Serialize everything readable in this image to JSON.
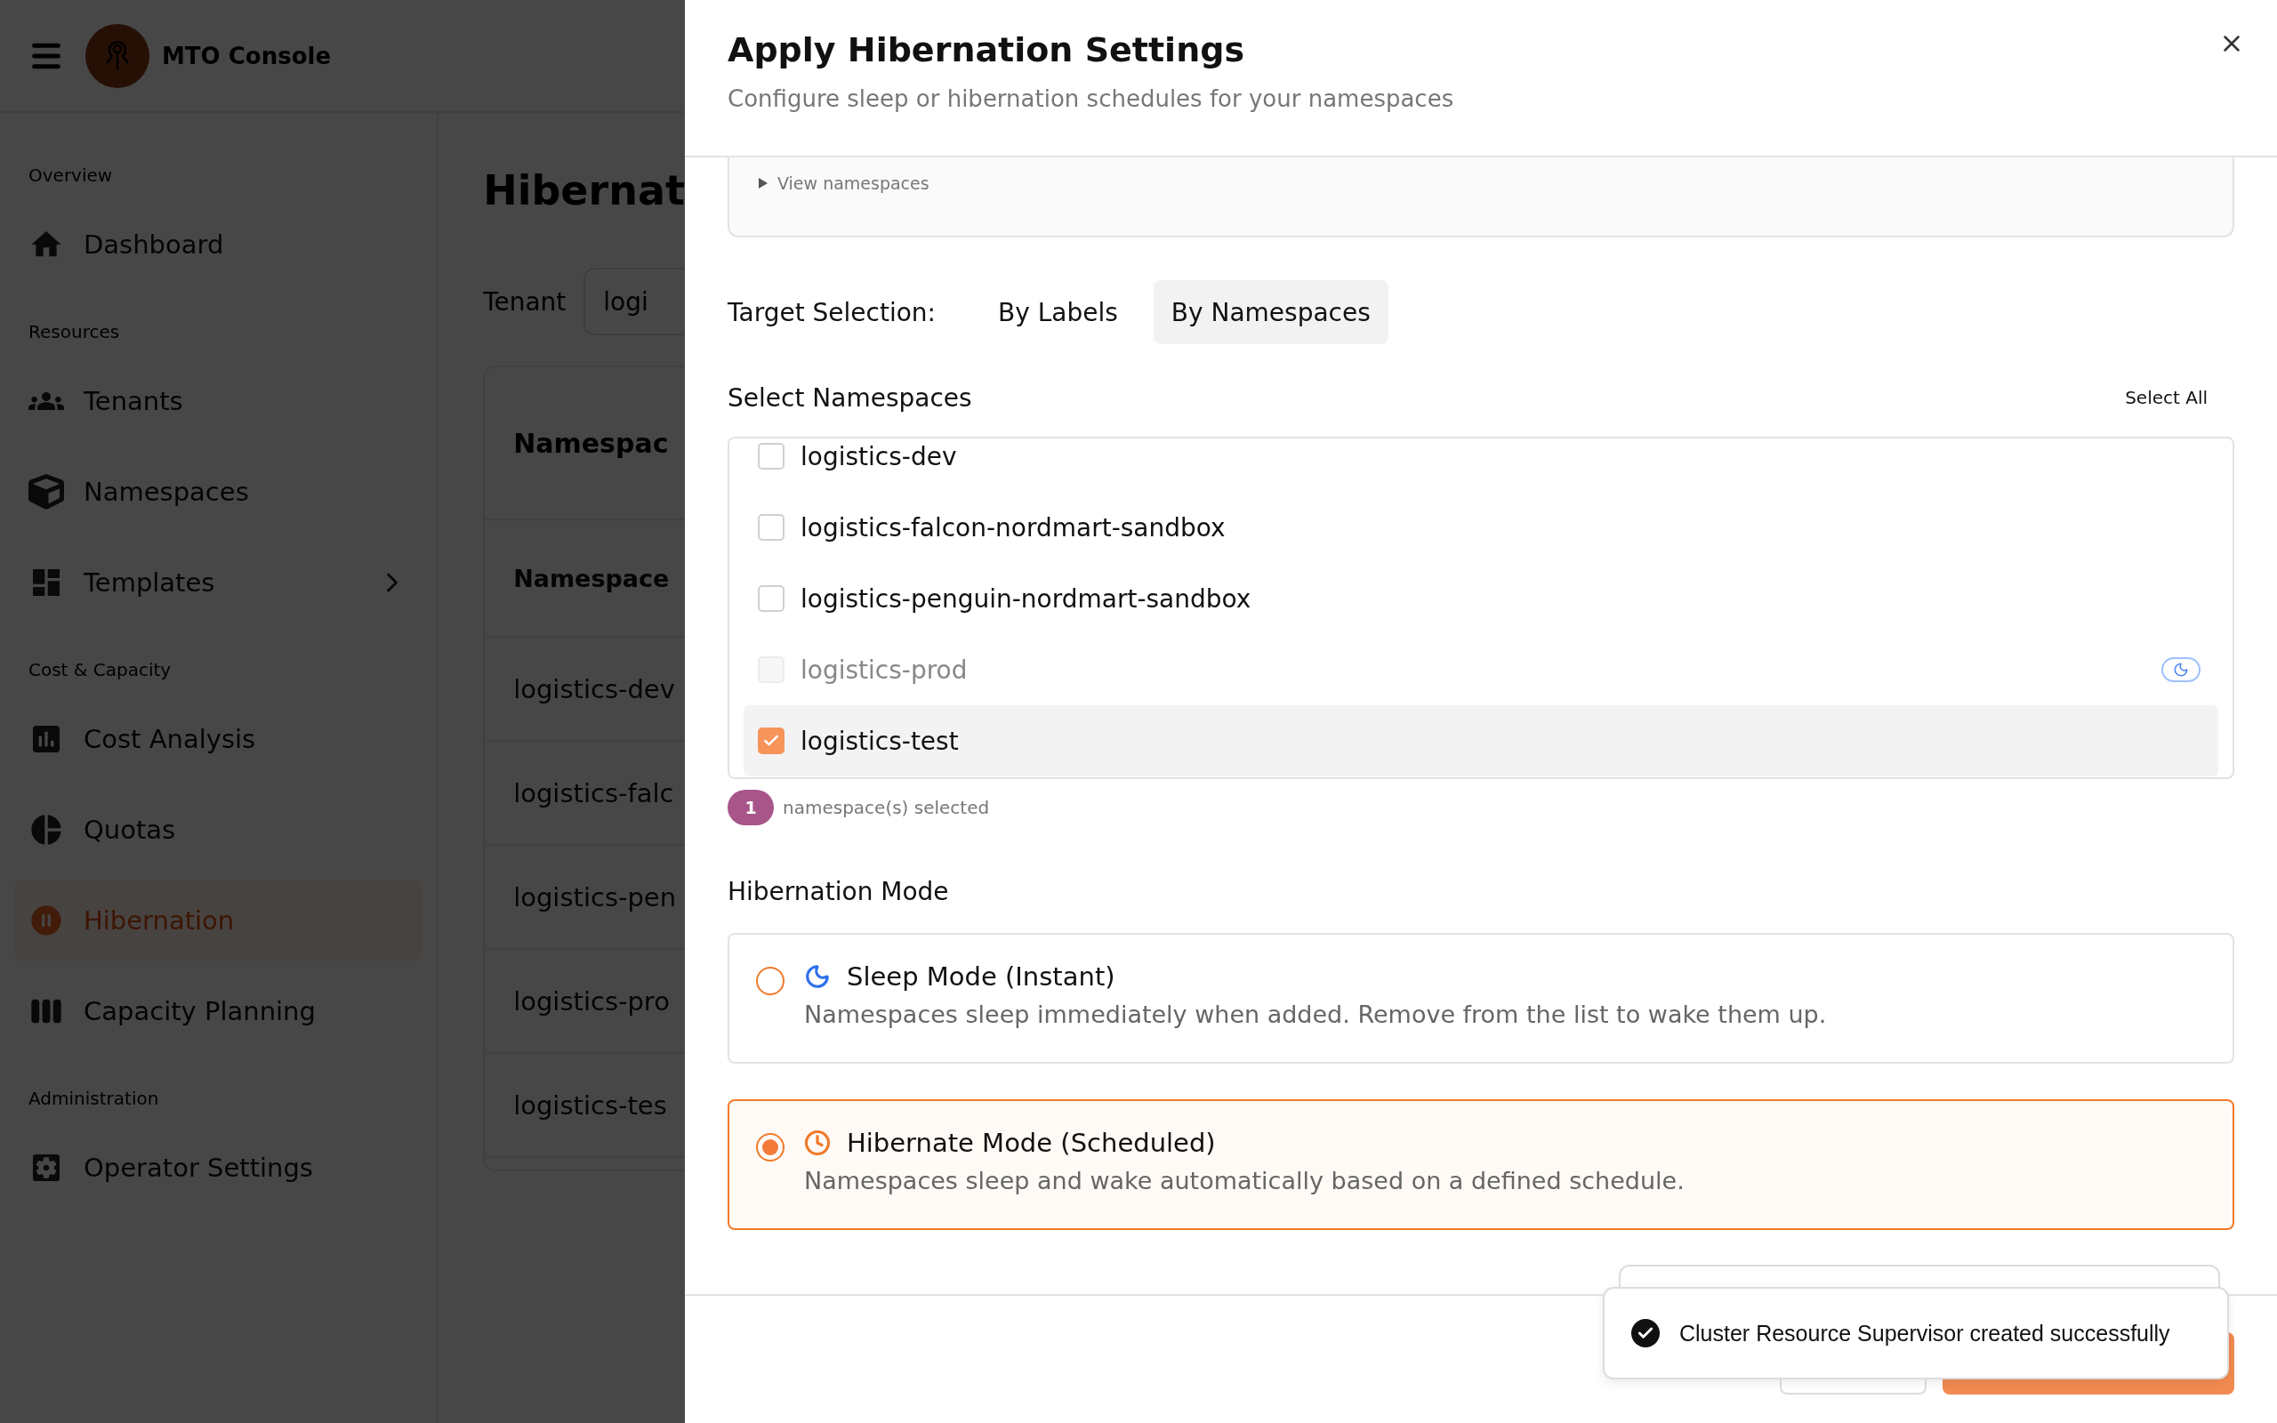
{
  "app": {
    "title": "MTO Console"
  },
  "sidebar": {
    "sections": [
      {
        "label": "Overview",
        "items": [
          {
            "label": "Dashboard",
            "selected": false,
            "has_submenu": false
          }
        ]
      },
      {
        "label": "Resources",
        "items": [
          {
            "label": "Tenants",
            "selected": false,
            "has_submenu": false
          },
          {
            "label": "Namespaces",
            "selected": false,
            "has_submenu": false
          },
          {
            "label": "Templates",
            "selected": false,
            "has_submenu": true
          }
        ]
      },
      {
        "label": "Cost & Capacity",
        "items": [
          {
            "label": "Cost Analysis",
            "selected": false,
            "has_submenu": false
          },
          {
            "label": "Quotas",
            "selected": false,
            "has_submenu": false
          },
          {
            "label": "Hibernation",
            "selected": true,
            "has_submenu": false
          },
          {
            "label": "Capacity Planning",
            "selected": false,
            "has_submenu": false
          }
        ]
      },
      {
        "label": "Administration",
        "items": [
          {
            "label": "Operator Settings",
            "selected": false,
            "has_submenu": false
          }
        ]
      }
    ]
  },
  "page": {
    "title": "Hibernat",
    "tenant_label": "Tenant",
    "tenant_value": "logi",
    "table": {
      "title": "Namespac",
      "column": "Namespace",
      "rows": [
        "logistics-dev",
        "logistics-falc",
        "logistics-pen",
        "logistics-pro",
        "logistics-tes"
      ]
    }
  },
  "modal": {
    "title": "Apply Hibernation Settings",
    "subtitle": "Configure sleep or hibernation schedules for your namespaces",
    "details": {
      "label": "View namespaces",
      "expanded": false
    },
    "target": {
      "label": "Target Selection:",
      "options": [
        {
          "label": "By Labels",
          "selected": false
        },
        {
          "label": "By Namespaces",
          "selected": true
        }
      ]
    },
    "namespaces": {
      "title": "Select Namespaces",
      "select_all": "Select All",
      "items": [
        {
          "name": "logistics-dev",
          "checked": false,
          "disabled": false,
          "sleeping": false
        },
        {
          "name": "logistics-falcon-nordmart-sandbox",
          "checked": false,
          "disabled": false,
          "sleeping": false
        },
        {
          "name": "logistics-penguin-nordmart-sandbox",
          "checked": false,
          "disabled": false,
          "sleeping": false
        },
        {
          "name": "logistics-prod",
          "checked": false,
          "disabled": true,
          "sleeping": true
        },
        {
          "name": "logistics-test",
          "checked": true,
          "disabled": false,
          "sleeping": false
        }
      ]
    },
    "count": "1",
    "count_label": "namespace(s) selected",
    "mode": {
      "title": "Hibernation Mode",
      "options": [
        {
          "kind": "sleep",
          "title": "Sleep Mode (Instant)",
          "description": "Namespaces sleep immediately when added. Remove from the list to wake them up.",
          "selected": false
        },
        {
          "kind": "hibernate",
          "title": "Hibernate Mode (Scheduled)",
          "description": "Namespaces sleep and wake automatically based on a defined schedule.",
          "selected": true
        }
      ]
    }
  },
  "toast": {
    "kind": "success",
    "message": "Cluster Resource Supervisor created successfully"
  }
}
